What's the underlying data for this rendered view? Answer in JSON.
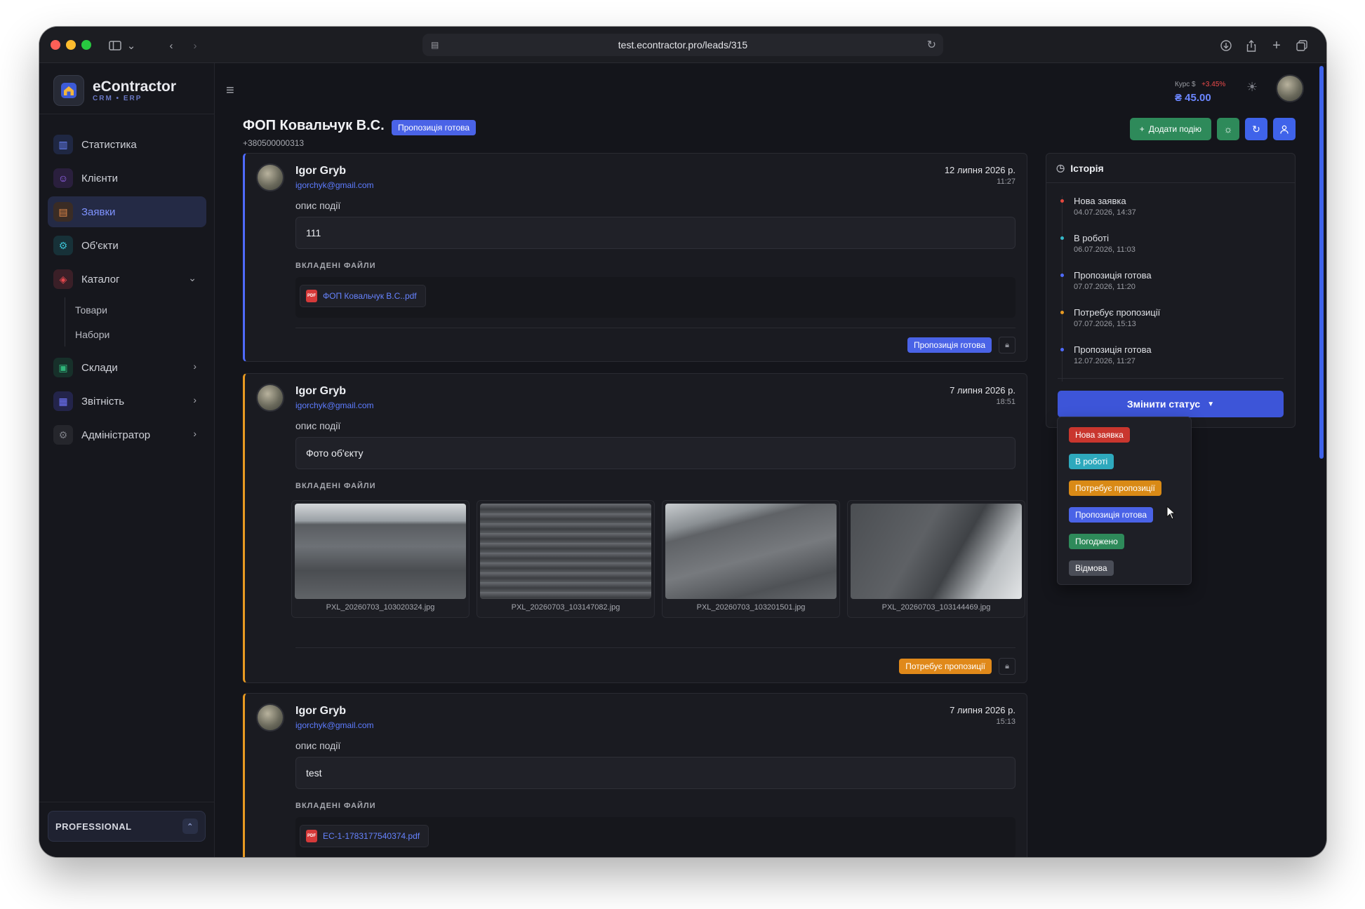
{
  "browser": {
    "url": "test.econtractor.pro/leads/315"
  },
  "brand": {
    "name": "eContractor",
    "tagline": "CRM • ERP"
  },
  "sidebar": {
    "items": [
      {
        "label": "Статистика",
        "icon": "bar-chart-icon"
      },
      {
        "label": "Клієнти",
        "icon": "users-icon"
      },
      {
        "label": "Заявки",
        "icon": "inbox-icon",
        "active": true
      },
      {
        "label": "Об'єкти",
        "icon": "building-icon"
      },
      {
        "label": "Каталог",
        "icon": "box-icon",
        "expanded": true,
        "children": [
          "Товари",
          "Набори"
        ]
      },
      {
        "label": "Склади",
        "icon": "warehouse-icon"
      },
      {
        "label": "Звітність",
        "icon": "report-icon"
      },
      {
        "label": "Адміністратор",
        "icon": "settings-icon"
      }
    ],
    "plan": "PROFESSIONAL"
  },
  "topbar": {
    "rate_label": "Курс $",
    "rate_change": "+3.45%",
    "rate_value": "₴ 45.00"
  },
  "lead": {
    "title": "ФОП Ковальчук В.С.",
    "status": "Пропозиція готова",
    "phone": "+380500000313"
  },
  "actions": {
    "add_event": "Додати подію"
  },
  "events": [
    {
      "author": "Igor Gryb",
      "email": "igorchyk@gmail.com",
      "date": "12 липня 2026 р.",
      "time": "11:27",
      "desc_label": "опис події",
      "desc": "111",
      "files_label": "ВКЛАДЕНІ ФАЙЛИ",
      "files": [
        "ФОП Ковальчук В.С..pdf"
      ],
      "status": "Пропозиція готова",
      "status_color": "#4a63e7"
    },
    {
      "author": "Igor Gryb",
      "email": "igorchyk@gmail.com",
      "date": "7 липня 2026 р.",
      "time": "18:51",
      "desc_label": "опис події",
      "desc": "Фото об'єкту",
      "files_label": "ВКЛАДЕНІ ФАЙЛИ",
      "photos": [
        "PXL_20260703_103020324.jpg",
        "PXL_20260703_103147082.jpg",
        "PXL_20260703_103201501.jpg",
        "PXL_20260703_103144469.jpg"
      ],
      "status": "Потребує пропозиції",
      "status_color": "#e0891a"
    },
    {
      "author": "Igor Gryb",
      "email": "igorchyk@gmail.com",
      "date": "7 липня 2026 р.",
      "time": "15:13",
      "desc_label": "опис події",
      "desc": "test",
      "files_label": "ВКЛАДЕНІ ФАЙЛИ",
      "files": [
        "EC-1-1783177540374.pdf"
      ]
    }
  ],
  "history": {
    "title": "Історія",
    "items": [
      {
        "title": "Нова заявка",
        "date": "04.07.2026, 14:37",
        "color": "#e5483e"
      },
      {
        "title": "В роботі",
        "date": "06.07.2026, 11:03",
        "color": "#35b8c9"
      },
      {
        "title": "Пропозиція готова",
        "date": "07.07.2026, 11:20",
        "color": "#4f6bff"
      },
      {
        "title": "Потребує пропозиції",
        "date": "07.07.2026, 15:13",
        "color": "#e89a22"
      },
      {
        "title": "Пропозиція готова",
        "date": "12.07.2026, 11:27",
        "color": "#4f6bff"
      }
    ],
    "change_status": "Змінити статус"
  },
  "status_options": [
    {
      "label": "Нова заявка",
      "color": "#c9362e"
    },
    {
      "label": "В роботі",
      "color": "#2ea9bd"
    },
    {
      "label": "Потребує пропозиції",
      "color": "#d98a16"
    },
    {
      "label": "Пропозиція готова",
      "color": "#4a63e7"
    },
    {
      "label": "Погоджено",
      "color": "#2e8a5a"
    },
    {
      "label": "Відмова",
      "color": "#4a4d57"
    }
  ]
}
